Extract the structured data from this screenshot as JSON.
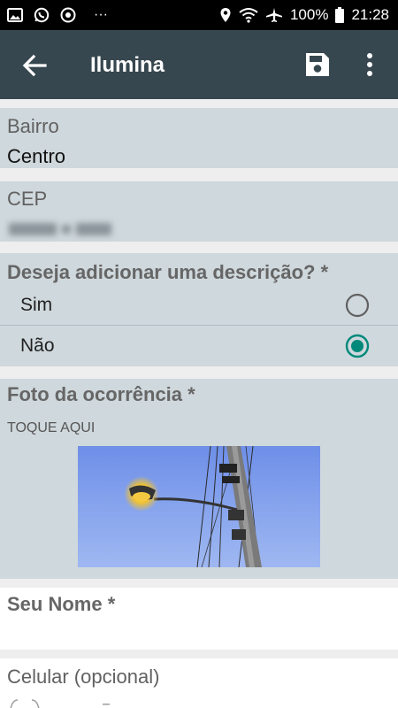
{
  "status_bar": {
    "battery": "100%",
    "time": "21:28",
    "overflow": "···",
    "icons": [
      "image-icon",
      "whatsapp-icon",
      "chrome-icon",
      "location-icon",
      "wifi-icon",
      "airplane-icon",
      "battery-icon"
    ]
  },
  "appbar": {
    "title": "Ilumina",
    "icons": [
      "back-arrow-icon",
      "save-icon",
      "more-vert-icon"
    ]
  },
  "form": {
    "bairro": {
      "label": "Bairro",
      "value": "Centro"
    },
    "cep": {
      "label": "CEP"
    },
    "descricao": {
      "question": "Deseja adicionar uma descrição? *",
      "options": [
        {
          "label": "Sim",
          "selected": false
        },
        {
          "label": "Não",
          "selected": true
        }
      ]
    },
    "foto": {
      "label": "Foto da ocorrência *",
      "tap_text": "TOQUE AQUI"
    },
    "nome": {
      "label": "Seu Nome *",
      "value": ""
    },
    "celular": {
      "label": "Celular (opcional)"
    }
  },
  "colors": {
    "appbar": "#37474f",
    "card": "#cfd8dc",
    "accent": "#00897b",
    "background": "#eeeeee"
  }
}
